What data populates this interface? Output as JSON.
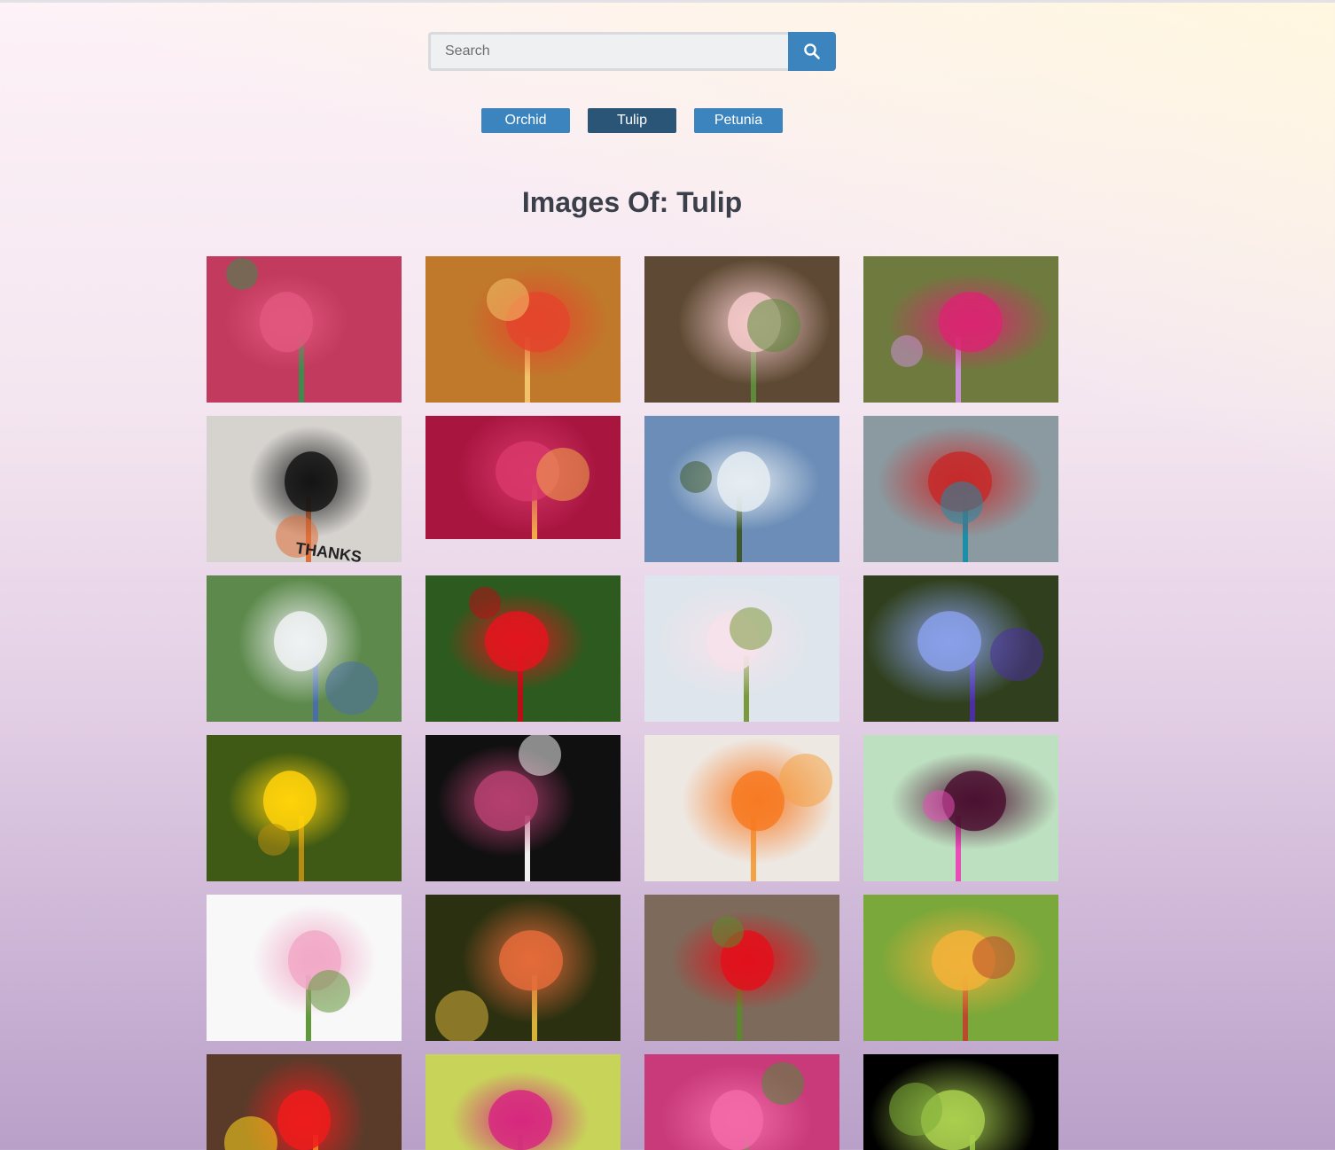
{
  "search": {
    "placeholder": "Search",
    "button_icon": "search-icon"
  },
  "filters": [
    {
      "label": "Orchid",
      "active": false
    },
    {
      "label": "Tulip",
      "active": true
    },
    {
      "label": "Petunia",
      "active": false
    }
  ],
  "heading": "Images Of: Tulip",
  "colors": {
    "accent": "#3b84bd",
    "accent_active": "#2a5576",
    "heading": "#3a3f4a"
  },
  "tiles": [
    {
      "subject": "pink-tulip-closeup",
      "bg": "#c23a5e",
      "c1": "#e2577e",
      "c2": "#3d8c4c"
    },
    {
      "subject": "orange-red-tulips-wood",
      "bg": "#c0782b",
      "c1": "#e4452b",
      "c2": "#f2c26a"
    },
    {
      "subject": "pale-pink-tulips-moss",
      "bg": "#5e4a34",
      "c1": "#f3c9c9",
      "c2": "#5c8b3a"
    },
    {
      "subject": "pink-tulips-garden",
      "bg": "#6f7a3e",
      "c1": "#d92671",
      "c2": "#c98fd4"
    },
    {
      "subject": "thanks-card-bear-fox",
      "bg": "#d6d3cf",
      "c1": "#141414",
      "c2": "#e0703a",
      "text": "THANKS"
    },
    {
      "subject": "pink-lily-closeup",
      "bg": "#a81640",
      "c1": "#d8376a",
      "c2": "#f3a94a"
    },
    {
      "subject": "glass-conservatory-sky",
      "bg": "#6b8db7",
      "c1": "#e6edf2",
      "c2": "#3e5a2d"
    },
    {
      "subject": "dotted-sculpture-conservatory",
      "bg": "#8a9aa0",
      "c1": "#c62a2a",
      "c2": "#1d8ea8"
    },
    {
      "subject": "conservatory-dome-trees",
      "bg": "#5d8a4c",
      "c1": "#f0f2f4",
      "c2": "#4a6fa8"
    },
    {
      "subject": "red-tulip-waterdrops",
      "bg": "#2d5a1e",
      "c1": "#e3151f",
      "c2": "#b80f17"
    },
    {
      "subject": "white-tulips-sky",
      "bg": "#dfe5ec",
      "c1": "#f6e2ea",
      "c2": "#7b9a3e"
    },
    {
      "subject": "blue-cornflower",
      "bg": "#30401e",
      "c1": "#8aa0ea",
      "c2": "#4b2fa0"
    },
    {
      "subject": "yellow-daisy",
      "bg": "#3f5a14",
      "c1": "#ffd20a",
      "c2": "#b58c10"
    },
    {
      "subject": "pink-peony-tulips-dark",
      "bg": "#101010",
      "c1": "#b54070",
      "c2": "#f0f0f0"
    },
    {
      "subject": "orange-tulips",
      "bg": "#eee8e2",
      "c1": "#f77a22",
      "c2": "#f4a246"
    },
    {
      "subject": "purple-tulip-pink-bg",
      "bg": "#bde0c0",
      "c1": "#4b1030",
      "c2": "#e84db8"
    },
    {
      "subject": "white-pink-tulip-bouquet",
      "bg": "#f8f8f8",
      "c1": "#f1a9c7",
      "c2": "#5f9a3a"
    },
    {
      "subject": "orange-daylily",
      "bg": "#2a3010",
      "c1": "#e46b3a",
      "c2": "#d8b33a"
    },
    {
      "subject": "red-tulip-soil",
      "bg": "#7d6a5a",
      "c1": "#e2111b",
      "c2": "#5b8a2c"
    },
    {
      "subject": "yellow-red-tulip-green",
      "bg": "#7aa83a",
      "c1": "#f2b23a",
      "c2": "#b94a2e"
    },
    {
      "subject": "red-tulips-fence",
      "bg": "#5a3b2a",
      "c1": "#ed1c1c",
      "c2": "#ffd81a"
    },
    {
      "subject": "pink-tulip-yellow-bg",
      "bg": "#c8d35a",
      "c1": "#d7287f",
      "c2": "#7ea84a"
    },
    {
      "subject": "pink-tulip-field",
      "bg": "#c83a7a",
      "c1": "#f36aa8",
      "c2": "#4e8a3a"
    },
    {
      "subject": "green-stems-black",
      "bg": "#000000",
      "c1": "#a9cf4f",
      "c2": "#7fae3a"
    }
  ]
}
